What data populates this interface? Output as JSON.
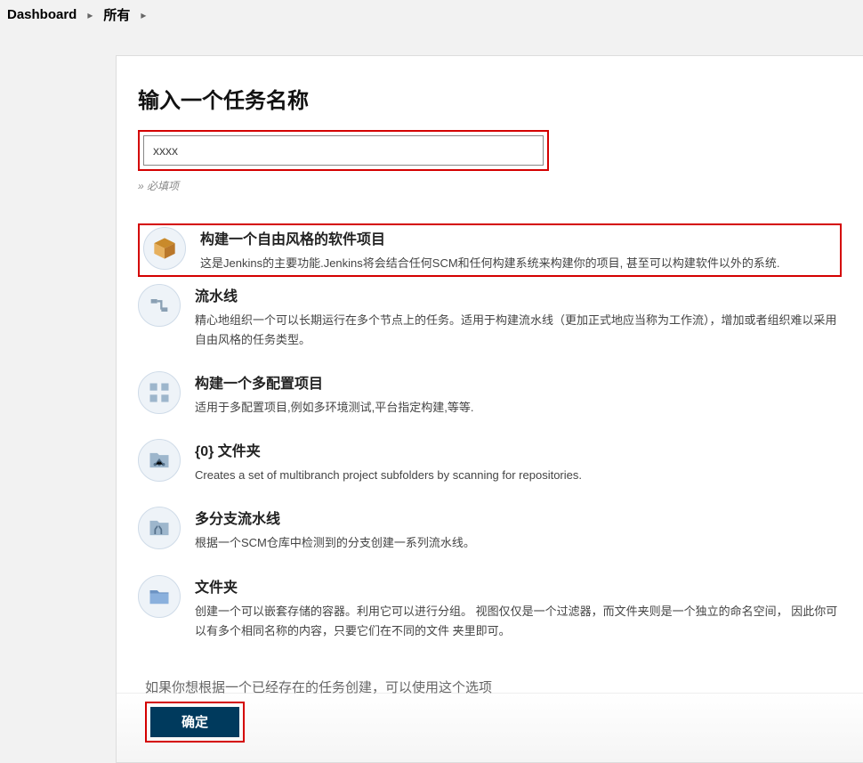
{
  "breadcrumb": {
    "dashboard": "Dashboard",
    "all": "所有"
  },
  "form": {
    "heading": "输入一个任务名称",
    "name_value": "xxxx",
    "required_hint": "» 必填项",
    "copy_hint": "如果你想根据一个已经存在的任务创建，可以使用这个选项",
    "ok_label": "确定"
  },
  "types": [
    {
      "id": "freestyle",
      "title": "构建一个自由风格的软件项目",
      "desc": "这是Jenkins的主要功能.Jenkins将会结合任何SCM和任何构建系统来构建你的项目, 甚至可以构建软件以外的系统.",
      "highlighted": true
    },
    {
      "id": "pipeline",
      "title": "流水线",
      "desc": "精心地组织一个可以长期运行在多个节点上的任务。适用于构建流水线（更加正式地应当称为工作流），增加或者组织难以采用自由风格的任务类型。"
    },
    {
      "id": "multiconfig",
      "title": "构建一个多配置项目",
      "desc": "适用于多配置项目,例如多环境测试,平台指定构建,等等."
    },
    {
      "id": "orgfolder",
      "title": "{0} 文件夹",
      "desc": "Creates a set of multibranch project subfolders by scanning for repositories."
    },
    {
      "id": "multibranch",
      "title": "多分支流水线",
      "desc": "根据一个SCM仓库中检测到的分支创建一系列流水线。"
    },
    {
      "id": "folder",
      "title": "文件夹",
      "desc": "创建一个可以嵌套存储的容器。利用它可以进行分组。 视图仅仅是一个过滤器，而文件夹则是一个独立的命名空间， 因此你可以有多个相同名称的内容，只要它们在不同的文件 夹里即可。"
    }
  ]
}
